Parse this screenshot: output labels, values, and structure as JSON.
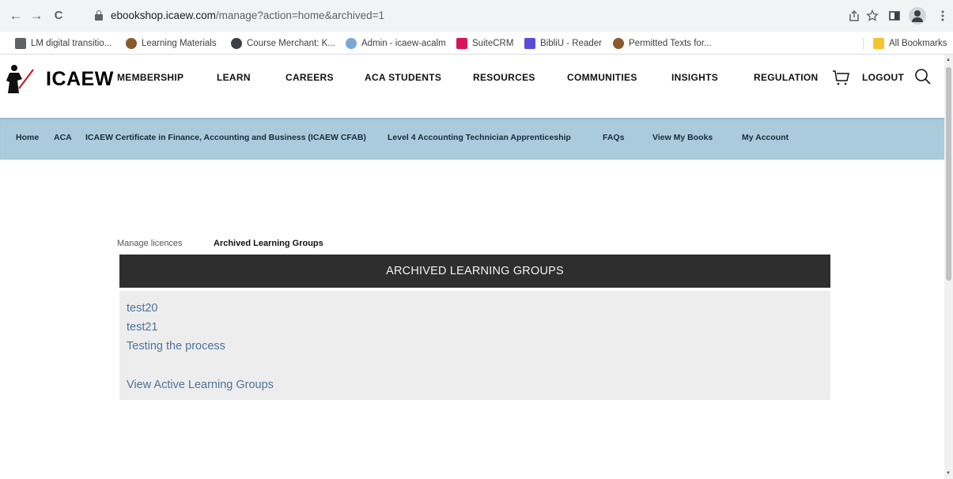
{
  "browser": {
    "url_host": "ebookshop.icaew.com",
    "url_path": "/manage?action=home&archived=1",
    "back_icon": "←",
    "forward_icon": "→",
    "reload_icon": "C"
  },
  "bookmarks": {
    "items": [
      {
        "label": "LM digital transitio...",
        "color": "#5f6368"
      },
      {
        "label": "Learning Materials",
        "color": "#8b5a2b"
      },
      {
        "label": "Course Merchant: K...",
        "color": "#3c4043"
      },
      {
        "label": "Admin - icaew-acalm",
        "color": "#7aa7d6"
      },
      {
        "label": "SuiteCRM",
        "color": "#d6155b"
      },
      {
        "label": "BibliU - Reader",
        "color": "#5b4bd6"
      },
      {
        "label": "Permitted Texts for...",
        "color": "#8b5a2b"
      }
    ],
    "all_bookmarks": "All Bookmarks",
    "all_bookmarks_color": "#f4c430"
  },
  "site": {
    "logo": "ICAEW",
    "nav": [
      "MEMBERSHIP",
      "LEARN",
      "CAREERS",
      "ACA STUDENTS",
      "RESOURCES",
      "COMMUNITIES",
      "INSIGHTS",
      "REGULATION"
    ],
    "logout": "LOGOUT",
    "subnav": [
      "Home",
      "ACA",
      "ICAEW Certificate in Finance, Accounting and Business (ICAEW CFAB)",
      "Level 4 Accounting Technician Apprenticeship",
      "FAQs",
      "View My Books",
      "My Account"
    ],
    "subnav_color": "#a9cbdc"
  },
  "main": {
    "tabs": {
      "manage": "Manage licences",
      "archived": "Archived Learning Groups"
    },
    "panel_title": "ARCHIVED LEARNING GROUPS",
    "groups": [
      "test20",
      "test21",
      "Testing the process"
    ],
    "view_active": "View Active Learning Groups",
    "link_color": "#4f7399"
  }
}
